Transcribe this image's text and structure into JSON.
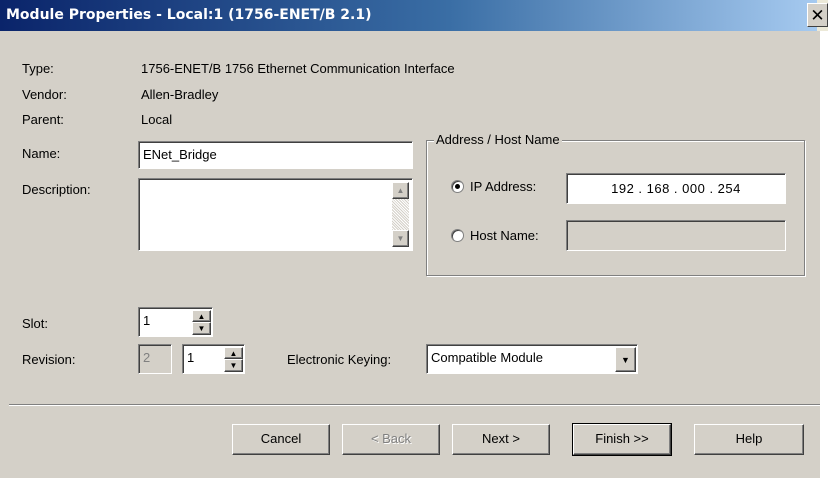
{
  "window": {
    "title": "Module Properties  - Local:1 (1756-ENET/B 2.1)",
    "close_symbol": "✕"
  },
  "info": {
    "type_label": "Type:",
    "type_value": "1756-ENET/B 1756 Ethernet Communication Interface",
    "vendor_label": "Vendor:",
    "vendor_value": "Allen-Bradley",
    "parent_label": "Parent:",
    "parent_value": "Local"
  },
  "name": {
    "label": "Name:",
    "value": "ENet_Bridge"
  },
  "description": {
    "label": "Description:",
    "value": ""
  },
  "address": {
    "group_label": "Address / Host Name",
    "ip_option_label": "IP Address:",
    "ip_selected": true,
    "ip_value": "192 . 168 . 000 . 254",
    "host_option_label": "Host Name:",
    "host_value": ""
  },
  "slot": {
    "label": "Slot:",
    "value": "1"
  },
  "revision": {
    "label": "Revision:",
    "major": "2",
    "minor": "1"
  },
  "keying": {
    "label": "Electronic Keying:",
    "selected": "Compatible Module"
  },
  "buttons": {
    "cancel": "Cancel",
    "back": "< Back",
    "next": "Next >",
    "finish": "Finish >>",
    "help": "Help"
  },
  "colors": {
    "titlebar_start": "#0a246a",
    "titlebar_end": "#a6caf0",
    "dialog_bg": "#d4d0c8"
  },
  "icons": {
    "close": "close-icon",
    "scroll_up": "scroll-up-arrow-icon",
    "scroll_down": "scroll-down-arrow-icon",
    "spin_up": "spin-up-arrow-icon",
    "spin_down": "spin-down-arrow-icon",
    "dropdown": "chevron-down-icon"
  }
}
